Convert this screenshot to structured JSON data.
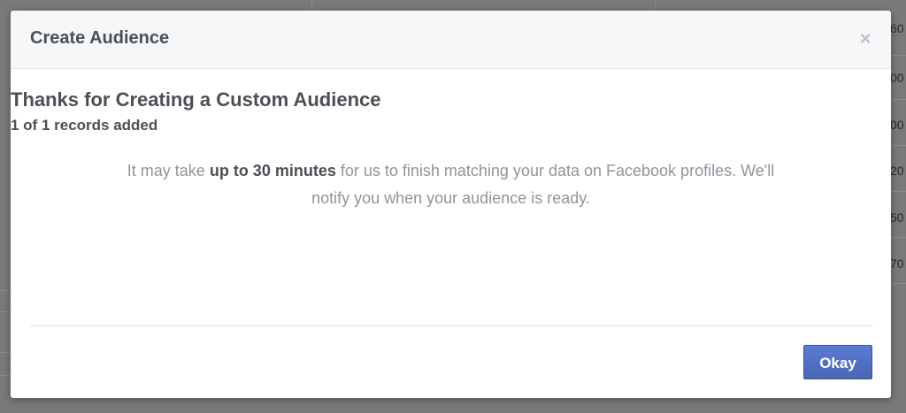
{
  "background": {
    "row_numbers": [
      "60",
      "00",
      "00",
      "20",
      "50",
      "70"
    ]
  },
  "dialog": {
    "title": "Create Audience",
    "close_symbol": "×",
    "headline": "Thanks for Creating a Custom Audience",
    "subhead": "1 of 1 records added",
    "message_prefix": "It may take ",
    "message_bold": "up to 30 minutes",
    "message_suffix": " for us to finish matching your data on Facebook profiles. We'll notify you when your audience is ready.",
    "okay_label": "Okay"
  },
  "colors": {
    "primary_button": "#4267b2",
    "title_text": "#4b4f56",
    "muted_text": "#90949c"
  }
}
